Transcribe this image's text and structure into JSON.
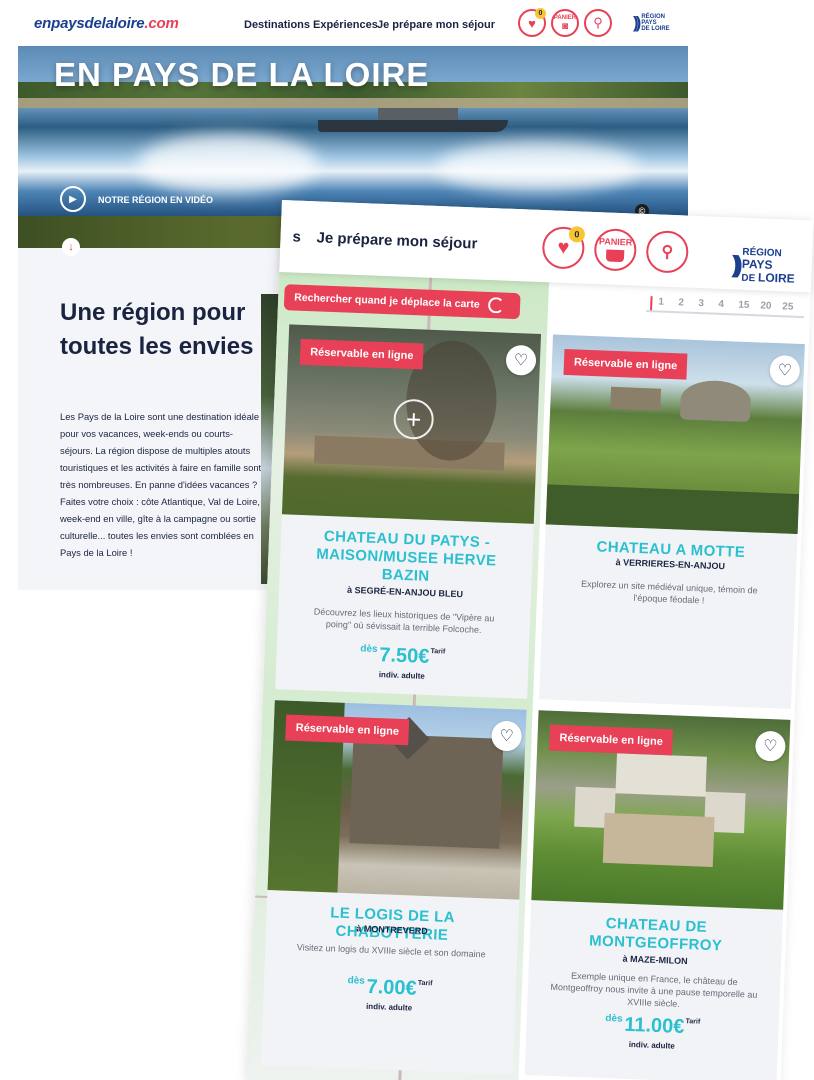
{
  "site": {
    "logo_main": "enpaysdelaloire",
    "logo_tld": ".com",
    "nav": [
      "Destinations",
      "Expériences",
      "Je prépare mon séjour"
    ],
    "fav_count": "0",
    "panier_label": "PANIER",
    "region_word": "RÉGION",
    "region_name_1": "PAYS",
    "region_name_2": "DE",
    "region_name_3": "LOIRE"
  },
  "hero": {
    "title": "EN PAYS DE LA LOIRE",
    "video_label": "NOTRE RÉGION EN VIDÉO",
    "copyright": "©"
  },
  "intro": {
    "heading": "Une région pour toutes les envies",
    "body": "Les Pays de la Loire sont une destination idéale pour vos vacances, week-ends ou courts-séjours. La région dispose de multiples atouts touristiques et les activités à faire en famille sont très nombreuses. En panne d'idées vacances ? Faites votre choix : côte Atlantique, Val de Loire, week-end en ville, gîte à la campagne ou sortie culturelle... toutes les envies sont comblées en Pays de la Loire !",
    "side_letter": "À"
  },
  "search_panel": {
    "header_title": "Je prépare mon séjour",
    "header_prefix": "s",
    "map_button": "Rechercher quand je déplace la carte",
    "pager": [
      "1",
      "2",
      "3",
      "4",
      "15",
      "20",
      "25"
    ],
    "badge_count": "0",
    "panier": "PANIER",
    "footer_snip": "Op"
  },
  "cards": [
    {
      "tag": "Réservable en ligne",
      "title": "CHATEAU DU PATYS - MAISON/MUSEE HERVE BAZIN",
      "city": "à SEGRÉ-EN-ANJOU BLEU",
      "desc": "Découvrez les lieux historiques de \"Vipère au poing\" où sévissait la terrible Folcoche.",
      "price_prefix": "dès",
      "price": "7.50€",
      "price_suffix": "Tarif",
      "indiv": "indiv. adulte"
    },
    {
      "tag": "Réservable en ligne",
      "title": "CHATEAU A MOTTE",
      "city": "à VERRIERES-EN-ANJOU",
      "desc": "Explorez un site médiéval unique, témoin de l'époque féodale !",
      "price_prefix": "",
      "price": "",
      "price_suffix": "",
      "indiv": ""
    },
    {
      "tag": "Réservable en ligne",
      "title": "LE LOGIS DE LA CHABOTTERIE",
      "city": "à MONTREVERD",
      "desc": "Visitez un logis du XVIIIe siècle et son domaine",
      "price_prefix": "dès",
      "price": "7.00€",
      "price_suffix": "Tarif",
      "indiv": "indiv. adulte"
    },
    {
      "tag": "Réservable en ligne",
      "title": "CHATEAU DE MONTGEOFFROY",
      "city": "à MAZE-MILON",
      "desc": "Exemple unique en France, le château de Montgeoffroy nous invite à une pause temporelle au XVIIIe siècle.",
      "price_prefix": "dès",
      "price": "11.00€",
      "price_suffix": "Tarif",
      "indiv": "indiv. adulte"
    }
  ],
  "colors": {
    "brand_red": "#e84057",
    "brand_blue": "#1b3f8f",
    "title_cyan": "#2ac0d0",
    "badge_yellow": "#f7c531"
  }
}
